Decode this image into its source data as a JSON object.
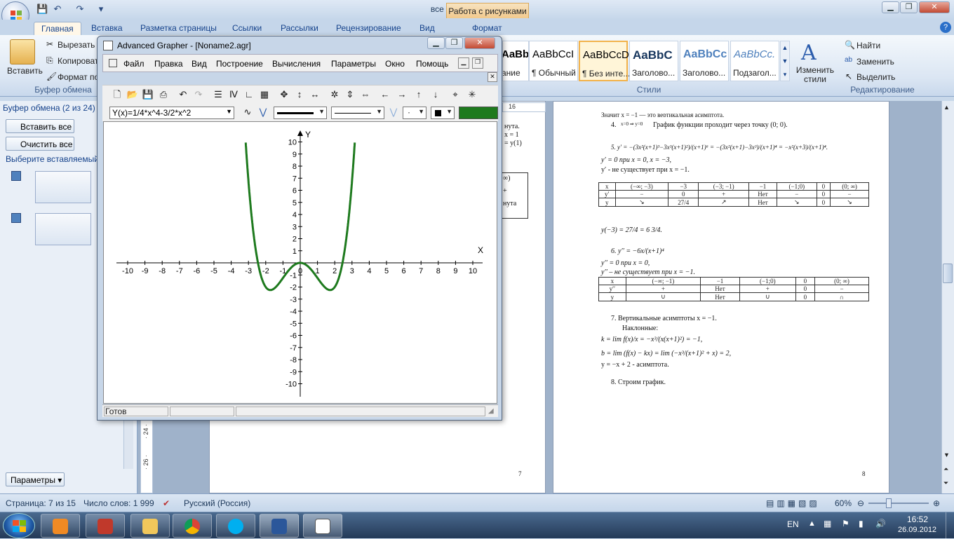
{
  "word": {
    "title": "все дкр - Microsoft Word",
    "context_tab": "Работа с рисунками",
    "tabs": [
      "Главная",
      "Вставка",
      "Разметка страницы",
      "Ссылки",
      "Рассылки",
      "Рецензирование",
      "Вид",
      "Формат"
    ],
    "clipboard_group": {
      "paste": "Вставить",
      "cut": "Вырезать",
      "copy": "Копировать",
      "format_painter": "Формат по образцу",
      "label": "Буфер обмена"
    },
    "styles": [
      {
        "sample": "AaBbC",
        "name": "ание"
      },
      {
        "sample": "AaBbCcI",
        "name": "¶ Обычный"
      },
      {
        "sample": "AaBbCcDc",
        "name": "¶ Без инте..."
      },
      {
        "sample": "AaBbC",
        "name": "Заголово..."
      },
      {
        "sample": "AaBbCc",
        "name": "Заголово..."
      },
      {
        "sample": "AaBbCc.",
        "name": "Подзагол..."
      }
    ],
    "styles_label": "Стили",
    "change_styles": "Изменить стили",
    "editing": {
      "find": "Найти",
      "replace": "Заменить",
      "select": "Выделить",
      "label": "Редактирование"
    },
    "clip_pane": {
      "header": "Буфер обмена (2 из 24)",
      "paste_all": "Вставить все",
      "clear_all": "Очистить все",
      "choose": "Выберите вставляемый о",
      "options": "Параметры"
    },
    "doc": {
      "partial_lines": [
        "нута.",
        "х = 1",
        "= y(1)"
      ],
      "partial_cells": [
        "∞)",
        "+",
        "нута"
      ],
      "ruler_label": "16",
      "top_line": "Значит x = −1 — это вертикальная асимптота.",
      "item4": "4.",
      "item4_text": "График функции проходит через точку (0; 0).",
      "item4_sys": "x=0 ⇒ y=0",
      "item5": "5.  y′ = −(3x²(x+1)³−3x³(x+1)²)/(x+1)⁶ = −(3x²(x+1)−3x³)/(x+1)⁴ = −x²(x+3)/(x+1)⁴.",
      "y1_zero": "y′ = 0 при x = 0, x = −3,",
      "y1_none": "y′ - не существует при x = −1.",
      "table1": [
        [
          "x",
          "(−∞; −3)",
          "−3",
          "(−3; −1)",
          "−1",
          "(−1;0)",
          "0",
          "(0; ∞)"
        ],
        [
          "y′",
          "−",
          "0",
          "+",
          "Нет",
          "−",
          "0",
          "−"
        ],
        [
          "y",
          "↘",
          "27/4",
          "↗",
          "Нет",
          "↘",
          "0",
          "↘"
        ]
      ],
      "ym3": "y(−3) = 27/4 = 6 3/4.",
      "item6": "6.  y′′ = −6x/(x+1)⁴",
      "y2_zero": "y′′ = 0  при  x = 0,",
      "y2_none": "y′′ – не существует при x = −1.",
      "table2": [
        [
          "x",
          "(−∞; −1)",
          "−1",
          "(−1;0)",
          "0",
          "(0; ∞)"
        ],
        [
          "y′′",
          "+",
          "Нет",
          "+",
          "0",
          "−"
        ],
        [
          "y",
          "∪",
          "Нет",
          "∪",
          "0",
          "∩"
        ]
      ],
      "item7": "7.  Вертикальные асимптоты x = −1.",
      "oblique": "Наклонные:",
      "k_line": "k = lim f(x)/x = −x³/(x(x+1)²) = −1,",
      "b_line": "b = lim (f(x) − kx) = lim (−x³/(x+1)² + x) = 2,",
      "asym_line": "y = −x + 2 - асимптота.",
      "item8": "8.  Строим график.",
      "page_num_left": "7",
      "page_num_right": "8",
      "side_ruler": "· 24 ·",
      "side_ruler2": "· 26 ·"
    },
    "status": {
      "page": "Страница: 7 из 15",
      "words": "Число слов: 1 999",
      "lang": "Русский (Россия)",
      "zoom": "60%"
    }
  },
  "grapher": {
    "title": "Advanced Grapher - [Noname2.agr]",
    "menu": [
      "Файл",
      "Правка",
      "Вид",
      "Построение",
      "Вычисления",
      "Параметры",
      "Окно",
      "Помощь"
    ],
    "formula": "Y(x)=1/4*x^4-3/2*x^2",
    "status": "Готов",
    "axis_x_label": "X",
    "axis_y_label": "Y",
    "curve_color": "#1e7a1e",
    "xlim": [
      -10,
      10
    ],
    "ylim": [
      -10,
      10
    ],
    "x_ticks": [
      "-10",
      "-9",
      "-8",
      "-7",
      "-6",
      "-5",
      "-4",
      "-3",
      "-2",
      "-1",
      "0",
      "1",
      "2",
      "3",
      "4",
      "5",
      "6",
      "7",
      "8",
      "9",
      "10"
    ],
    "y_ticks": [
      "10",
      "9",
      "8",
      "7",
      "6",
      "5",
      "4",
      "3",
      "2",
      "1",
      "-1",
      "-2",
      "-3",
      "-4",
      "-5",
      "-6",
      "-7",
      "-8",
      "-9",
      "-10"
    ]
  },
  "taskbar": {
    "lang": "EN",
    "time": "16:52",
    "date": "26.09.2012",
    "apps": [
      "media-player",
      "mathcad",
      "explorer",
      "chrome",
      "skype",
      "word",
      "advanced-grapher"
    ]
  }
}
